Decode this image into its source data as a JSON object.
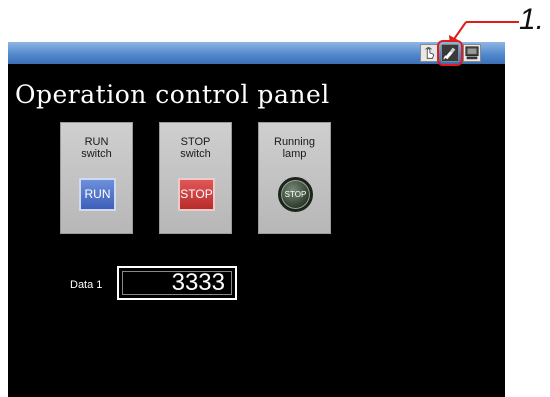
{
  "callout": {
    "label": "1."
  },
  "titlebar": {
    "icons": [
      "touch-icon",
      "pen-tool-icon",
      "screen-icon"
    ],
    "highlight_color": "#e21b1b"
  },
  "panel": {
    "title": "Operation control panel",
    "cards": [
      {
        "label": "RUN\nswitch",
        "button": "RUN",
        "color": "#4a6cc6"
      },
      {
        "label": "STOP\nswitch",
        "button": "STOP",
        "color": "#c83a3a"
      },
      {
        "label": "Running\nlamp",
        "lamp": "STOP",
        "color": "#2f3f2f"
      }
    ],
    "data": {
      "label": "Data 1",
      "value": "3333"
    }
  },
  "colors": {
    "background": "#000000",
    "titlebar": "#4f86cc"
  }
}
